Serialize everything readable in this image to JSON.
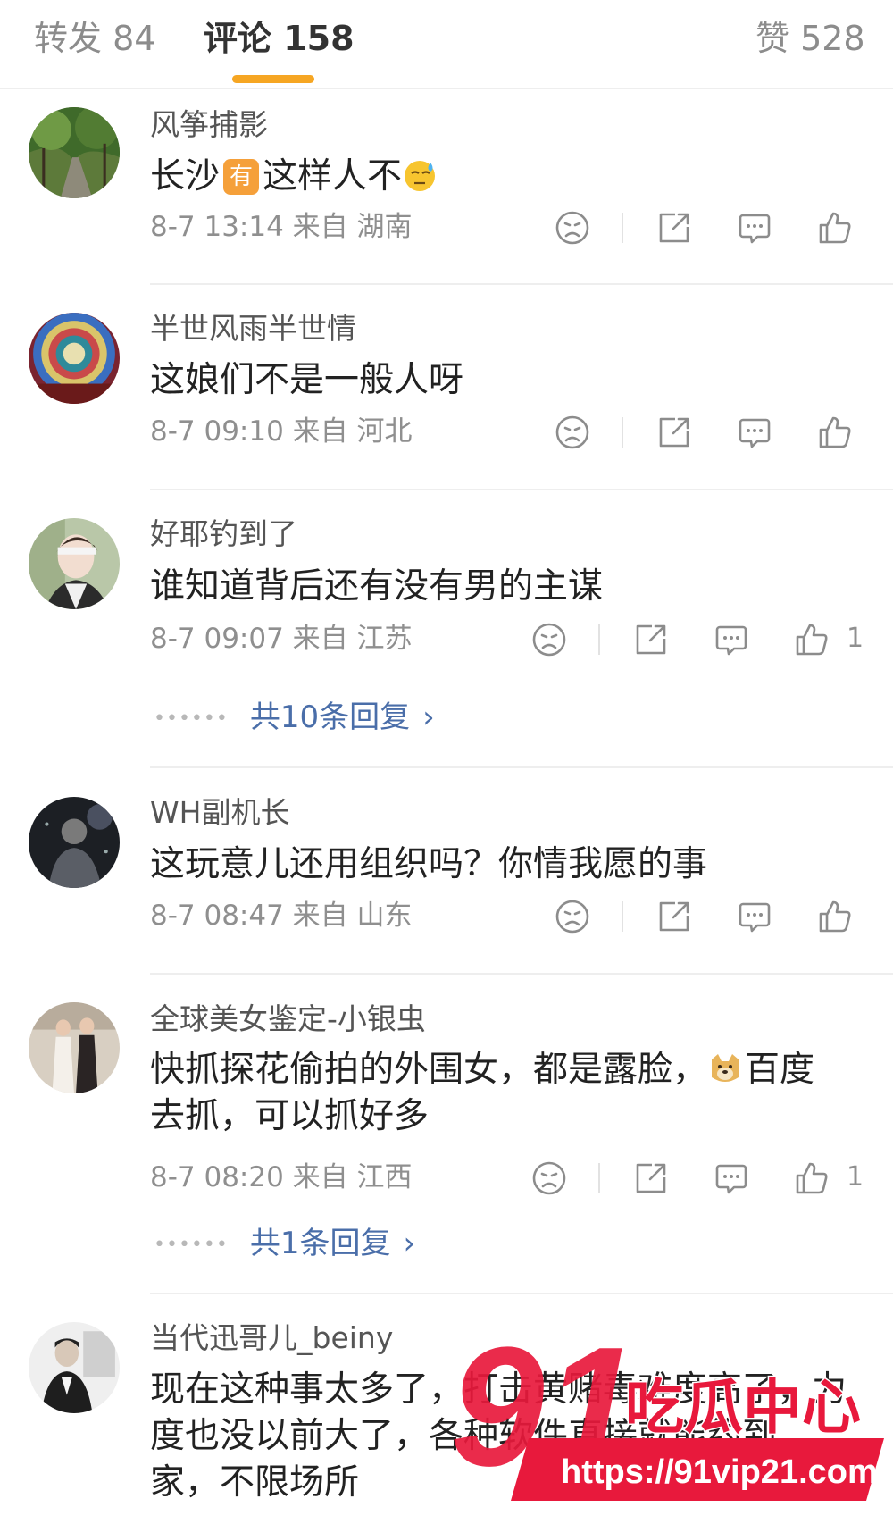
{
  "tabs": {
    "repost": "转发 84",
    "comments": "评论 158",
    "likes": "赞 528",
    "accent_color": "#f6a623"
  },
  "comments": [
    {
      "username": "风筝捕影",
      "text_parts": [
        "长沙",
        "有",
        "这样人不"
      ],
      "meta": "8-7 13:14 来自 湖南",
      "like_count": ""
    },
    {
      "username": "半世风雨半世情",
      "text": "这娘们不是一般人呀",
      "meta": "8-7 09:10 来自 河北",
      "like_count": ""
    },
    {
      "username": "好耶钓到了",
      "text": "谁知道背后还有没有男的主谋",
      "meta": "8-7 09:07 来自 江苏",
      "like_count": "1",
      "replies": "共10条回复"
    },
    {
      "username": "WH副机长",
      "text": "这玩意儿还用组织吗？你情我愿的事",
      "meta": "8-7 08:47 来自 山东",
      "like_count": ""
    },
    {
      "username": "全球美女鉴定-小银虫",
      "text_line1a": "快抓探花偷拍的外围女，都是露脸，",
      "text_line1b": "百度",
      "text_line2": "去抓，可以抓好多",
      "meta": "8-7 08:20 来自 江西",
      "like_count": "1",
      "replies": "共1条回复"
    },
    {
      "username": "当代迅哥儿_beiny",
      "text_line1": "现在这种事太多了，打击黄赌毒难度高了，力",
      "text_line2": "度也没以前大了，各种软件直接就能约到",
      "text_line3": "家，不限场所"
    }
  ],
  "icons": {
    "dislike": "dislike-face-icon",
    "share": "share-icon",
    "reply": "comment-bubble-icon",
    "like": "thumbs-up-icon",
    "chevron": "chevron-right-icon"
  },
  "watermark": {
    "logo_number": "91",
    "logo_text": "吃瓜中心",
    "url": "https://91vip21.com",
    "color": "#e8193c"
  }
}
